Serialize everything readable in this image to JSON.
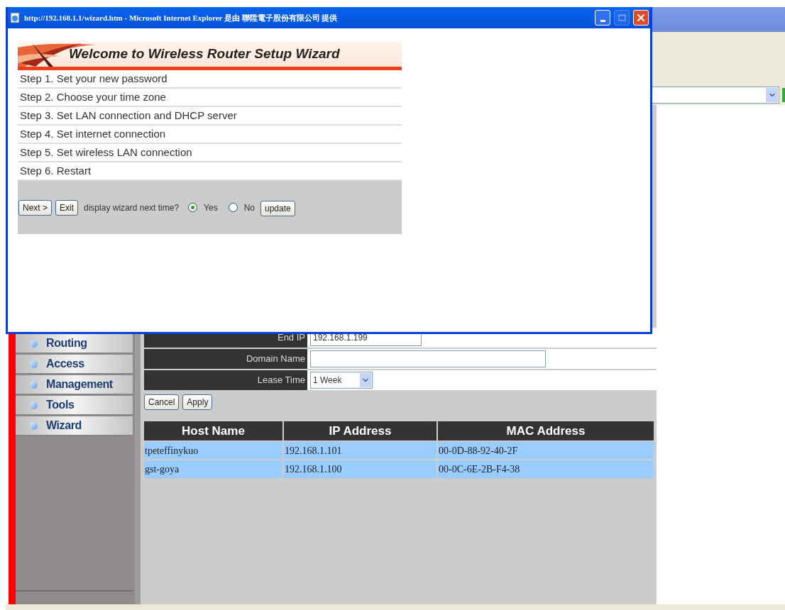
{
  "popup": {
    "title": "http://192.168.1.1/wizard.htm - Microsoft Internet Explorer 是由 聯陞電子股份有限公司 提供",
    "banner_title": "Welcome to Wireless Router Setup Wizard",
    "steps": [
      "Step 1. Set your new password",
      "Step 2. Choose your time zone",
      "Step 3. Set LAN connection and DHCP server",
      "Step 4. Set internet connection",
      "Step 5. Set wireless LAN connection",
      "Step 6. Restart"
    ],
    "buttons": [
      "Next >",
      "Exit"
    ],
    "prompt": "display wizard next time?",
    "options": [
      {
        "label": "Yes",
        "selected": true
      },
      {
        "label": "No",
        "selected": false
      }
    ],
    "update_button": "update"
  },
  "sidebar": {
    "items": [
      {
        "label": "Routing"
      },
      {
        "label": "Access"
      },
      {
        "label": "Management"
      },
      {
        "label": "Tools"
      },
      {
        "label": "Wizard"
      }
    ]
  },
  "form": {
    "fields": [
      {
        "label": "End IP",
        "kind": "text",
        "value": "192.168.1.199"
      },
      {
        "label": "Domain Name",
        "kind": "wide_text"
      },
      {
        "label": "Lease Time",
        "kind": "select",
        "value": "1 Week"
      }
    ],
    "buttons": [
      "Cancel",
      "Apply"
    ]
  },
  "table": {
    "columns": [
      "Host Name",
      "IP Address",
      "MAC Address"
    ],
    "rows": [
      [
        "tpeteffinykuo",
        "192.168.1.101",
        "00-0D-88-92-40-2F"
      ],
      [
        "gst-goya",
        "192.168.1.100",
        "00-0C-6E-2B-F4-38"
      ]
    ]
  }
}
